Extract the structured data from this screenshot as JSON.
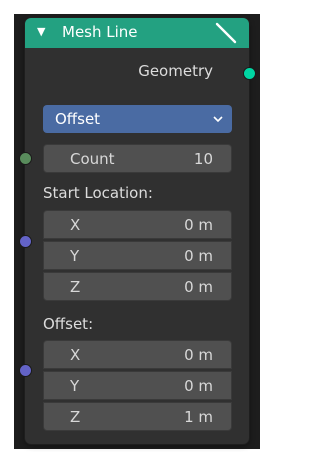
{
  "node": {
    "title": "Mesh Line",
    "header_color": "#23a181",
    "output_label": "Geometry",
    "mode": "Offset",
    "count": {
      "label": "Count",
      "value": "10"
    },
    "start_location": {
      "label": "Start Location:",
      "x": {
        "label": "X",
        "value": "0 m"
      },
      "y": {
        "label": "Y",
        "value": "0 m"
      },
      "z": {
        "label": "Z",
        "value": "0 m"
      }
    },
    "offset": {
      "label": "Offset:",
      "x": {
        "label": "X",
        "value": "0 m"
      },
      "y": {
        "label": "Y",
        "value": "0 m"
      },
      "z": {
        "label": "Z",
        "value": "1 m"
      }
    }
  },
  "colors": {
    "geometry_socket": "#00d6a3",
    "integer_socket": "#598c5c",
    "vector_socket": "#6363c7",
    "dropdown": "#4a6ba3"
  },
  "icons": {
    "collapse": "chevron-down-icon",
    "node_type": "mesh-line-icon",
    "dropdown": "caret-down-icon"
  }
}
